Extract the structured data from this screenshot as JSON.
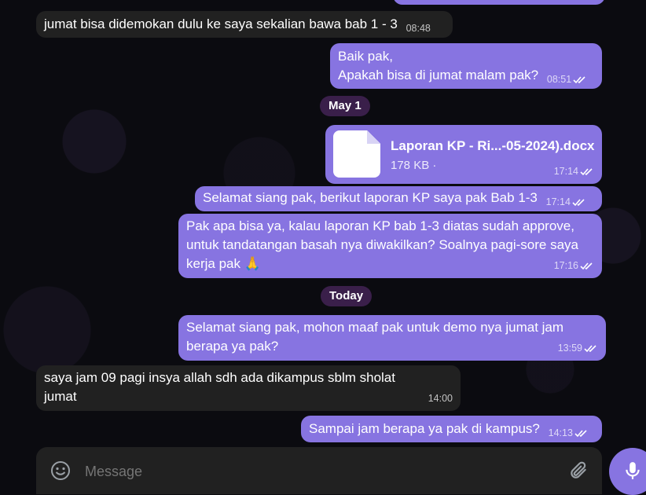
{
  "messages": [
    {
      "text": "jumat bisa didemokan dulu ke saya sekalian bawa bab 1 - 3",
      "time": "08:48"
    },
    {
      "line1": "Baik pak,",
      "line2": "Apakah bisa di jumat malam pak?",
      "time": "08:51"
    },
    {
      "file_name": "Laporan KP - Ri...-05-2024).docx",
      "file_size": "178 KB ·",
      "time": "17:14"
    },
    {
      "text": "Selamat siang pak, berikut laporan KP saya pak Bab 1-3",
      "time": "17:14"
    },
    {
      "line1": "Pak apa bisa ya, kalau laporan KP bab 1-3 diatas sudah approve,",
      "line2": "untuk tandatangan basah nya diwakilkan? Soalnya pagi-sore saya",
      "line3": "kerja pak 🙏",
      "time": "17:16"
    },
    {
      "line1": "Selamat siang pak, mohon maaf pak untuk demo nya jumat jam",
      "line2": "berapa ya pak?",
      "time": "13:59"
    },
    {
      "line1": "saya jam 09 pagi insya allah sdh ada dikampus sblm sholat",
      "line2": "jumat",
      "time": "14:00"
    },
    {
      "text": "Sampai jam berapa ya pak di kampus?",
      "time": "14:13"
    }
  ],
  "dates": [
    "May 1",
    "Today"
  ],
  "composer": {
    "placeholder": "Message"
  },
  "icons": {
    "emoji": "emoji-icon",
    "attach": "paperclip-icon",
    "mic": "microphone-icon",
    "read": "double-check-icon"
  },
  "colors": {
    "outgoing": "#8774e1",
    "incoming": "#212121",
    "date_pill": "#3a1f4a",
    "background": "#0b0b10"
  }
}
